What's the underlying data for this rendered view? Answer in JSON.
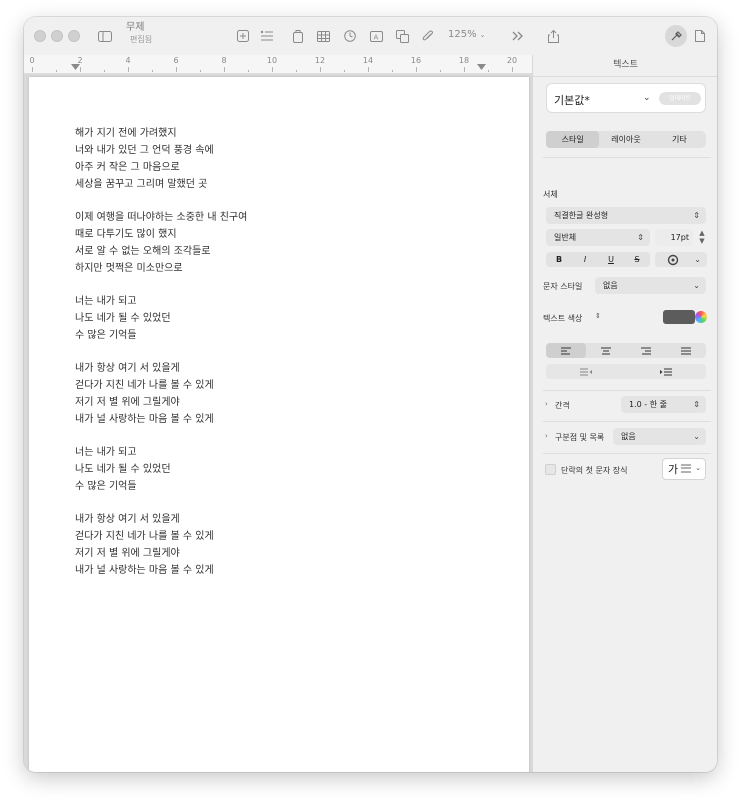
{
  "document": {
    "title": "무제",
    "subtitle": "편집됨",
    "zoom": "125%"
  },
  "ruler": {
    "labels": [
      "0",
      "2",
      "4",
      "6",
      "8",
      "10",
      "12",
      "14",
      "16",
      "18",
      "20"
    ]
  },
  "lyrics": {
    "stanzas": [
      [
        "해가 지기 전에 가려했지",
        "너와 내가 있던 그 언덕 풍경 속에",
        "아주 커 작은 그 마음으로",
        "세상을 꿈꾸고 그리며 말했던 곳"
      ],
      [
        "이제 여행을 떠나야하는 소중한 내 친구여",
        "때로 다투기도 많이 했지",
        "서로 알 수 없는 오해의 조각들로",
        "하지만 멋쩍은 미소만으로"
      ],
      [
        "너는 내가 되고",
        "나도 네가 될 수 있었던",
        "수 많은 기억들"
      ],
      [
        "내가 항상 여기 서 있을게",
        "걷다가 지친 네가 나를 볼 수 있게",
        "저기 저 별 위에 그릴게야",
        "내가 널 사랑하는 마음 볼 수 있게"
      ],
      [
        "너는 내가 되고",
        "나도 네가 될 수 있었던",
        "수 많은 기억들"
      ],
      [
        "내가 항상 여기 서 있을게",
        "걷다가 지친 네가 나를 볼 수 있게",
        "저기 저 별 위에 그릴게야",
        "내가 널 사랑하는 마음 볼 수 있게"
      ]
    ]
  },
  "inspector": {
    "header": "텍스트",
    "paragraph_style": "기본값*",
    "update_label": "업데이트",
    "tabs": [
      "스타일",
      "레이아웃",
      "기타"
    ],
    "active_tab": "스타일",
    "font_section": "서체",
    "font_family": "직결한글 완성형",
    "font_style": "일반체",
    "font_size": "17pt",
    "format_buttons": [
      "B",
      "I",
      "U",
      "S"
    ],
    "char_style_label": "문자 스타일",
    "char_style_value": "없음",
    "text_color_label": "텍스트 색상",
    "text_color": "#5c5c5c",
    "spacing_label": "간격",
    "spacing_value": "1.0 - 한 줄",
    "bullets_label": "구분점 및 목록",
    "bullets_value": "없음",
    "dropcap_label": "단락의 첫 문자 장식",
    "dropcap_glyph": "가"
  },
  "icons": [
    "sidebar-icon",
    "add-icon",
    "list-icon",
    "chart-icon",
    "table-icon",
    "clock-icon",
    "textbox-icon",
    "shape-icon",
    "media-icon",
    "more-icon",
    "share-icon",
    "format-icon",
    "document-icon"
  ]
}
